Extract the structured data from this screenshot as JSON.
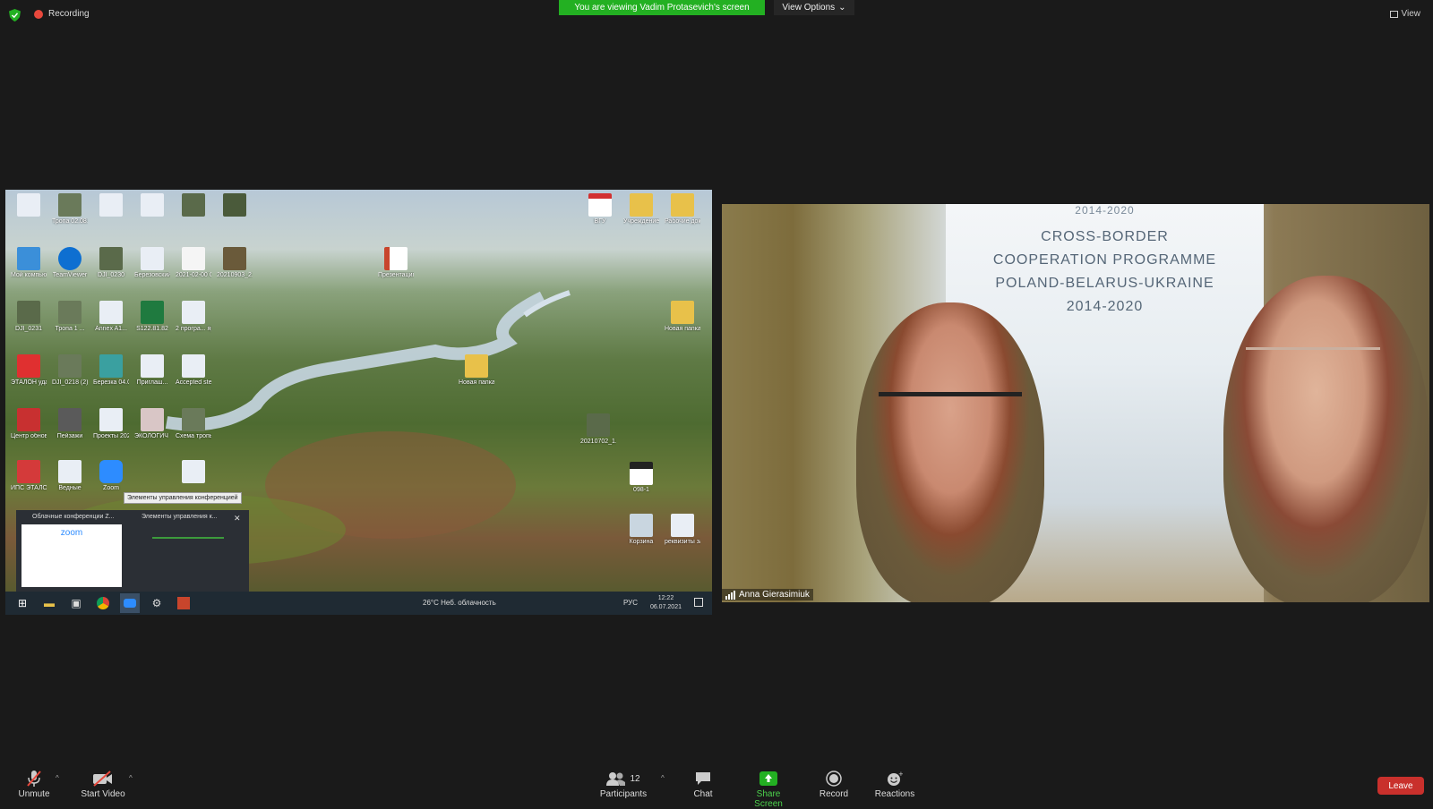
{
  "top": {
    "recording": "Recording",
    "viewing_banner": "You are viewing Vadim Protasevich's screen",
    "view_options": "View Options",
    "view": "View"
  },
  "shared_screen": {
    "desktop_icons_left": [
      "",
      "Тропа 02.08.2021",
      "",
      "",
      "",
      "",
      "Мой компьютер",
      "TeamViewer",
      "DJI_0230",
      "Березовский районный...",
      "2021-02-00 Охрана...",
      "20210903_2...",
      "DJI_0231",
      "Тропа 1 ...",
      "Annex A1...",
      "S122.81.82",
      "2 програ... ярмарки.ГТ",
      "ЭТАЛОН удален...",
      "DJI_0218 (2)",
      "Березка 04.03.21",
      "Приглаш...",
      "Accepted step 1 letter",
      "Центр обновлений",
      "Пейзажи",
      "Проекты 2021",
      "ЭКОЛОГИЧ ТРОПА",
      "Схема тропы пер...",
      "ИПС ЭТАЛОН",
      "Ведные",
      "Zoom",
      ""
    ],
    "desktop_icons_center": [
      "Презентация ...копия",
      "Новая папка",
      "20210702_1..."
    ],
    "desktop_icons_right": [
      "ВГУ",
      "Учреждение",
      "Рабочие документы",
      "Новая папка (2)",
      "098-1",
      "Корзина",
      "реквизиты заказчик..."
    ],
    "tooltip": "Элементы управления конференцией",
    "popup_tab1": "Облачные конференции Z...",
    "popup_tab2": "Элементы управления к...",
    "zoom_logo": "zoom",
    "weather": "26°C  Неб. облачность",
    "lang": "РУС",
    "time": "12:22",
    "date": "06.07.2021"
  },
  "video": {
    "banner_lines": [
      "2014-2020",
      "CROSS-BORDER",
      "COOPERATION PROGRAMME",
      "POLAND-BELARUS-UKRAINE",
      "2014-2020"
    ],
    "participant_name": "Anna Gierasimiuk"
  },
  "toolbar": {
    "unmute": "Unmute",
    "start_video": "Start Video",
    "participants": "Participants",
    "participant_count": "12",
    "chat": "Chat",
    "share_screen": "Share Screen",
    "record": "Record",
    "reactions": "Reactions",
    "leave": "Leave"
  },
  "colors": {
    "share_green": "#23b022",
    "leave_red": "#c9302c"
  }
}
